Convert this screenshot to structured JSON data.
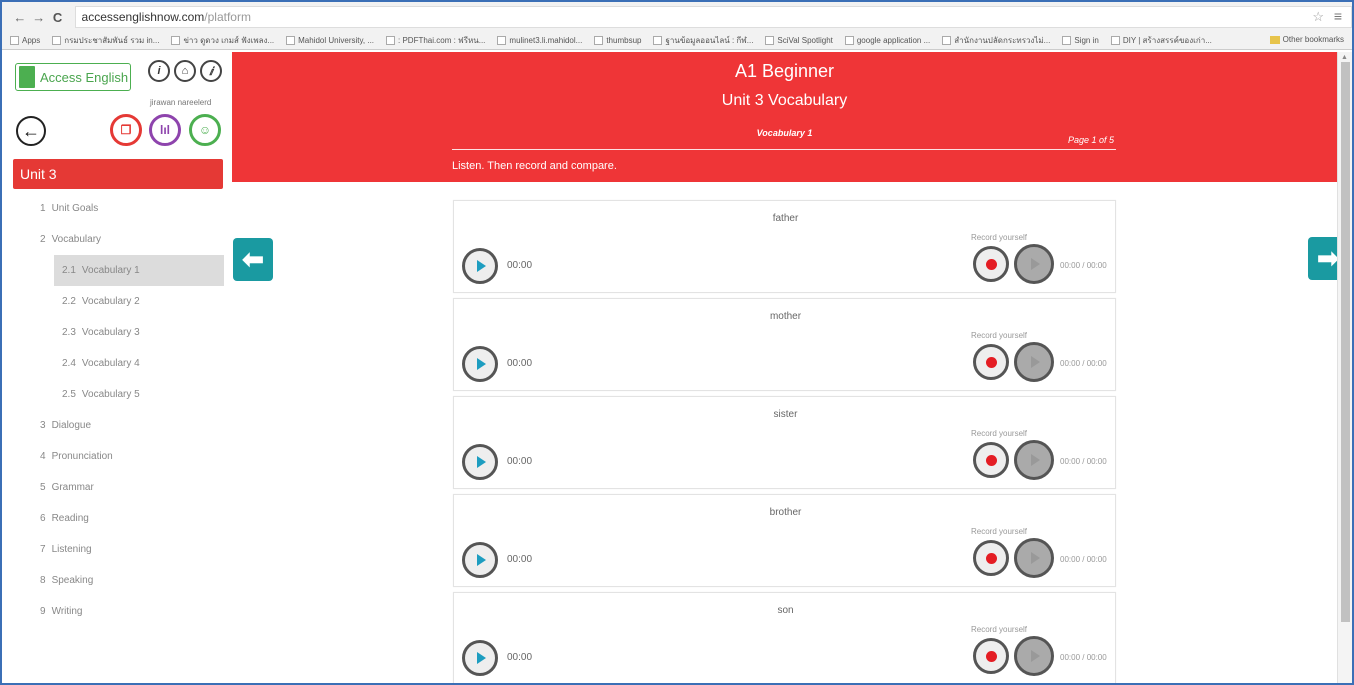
{
  "browser": {
    "url_host": "accessenglishnow.com",
    "url_path": "/platform",
    "bookmarks": [
      "Apps",
      "กรมประชาสัมพันธ์ รวม in...",
      "ข่าว ดูดวง เกมส์ ฟังเพลง...",
      "Mahidol University, ...",
      ": PDFThai.com : ฟรีหน...",
      "mulinet3.li.mahidol...",
      "thumbsup",
      "ฐานข้อมูลออนไลน์ : กีฬ...",
      "SciVal Spotlight",
      "google application ...",
      "สำนักงานปลัดกระทรวงไม่...",
      "Sign in",
      "DIY | สร้างสรรค์ของเก่า..."
    ],
    "other_bookmarks": "Other bookmarks"
  },
  "sidebar": {
    "logo_text": "Access English",
    "username": "jirawan nareelerd",
    "unit_title": "Unit 3",
    "menu": [
      {
        "num": "1",
        "label": "Unit Goals",
        "level": "top"
      },
      {
        "num": "2",
        "label": "Vocabulary",
        "level": "top"
      },
      {
        "num": "2.1",
        "label": "Vocabulary 1",
        "level": "sub",
        "active": true
      },
      {
        "num": "2.2",
        "label": "Vocabulary 2",
        "level": "sub"
      },
      {
        "num": "2.3",
        "label": "Vocabulary 3",
        "level": "sub"
      },
      {
        "num": "2.4",
        "label": "Vocabulary 4",
        "level": "sub"
      },
      {
        "num": "2.5",
        "label": "Vocabulary 5",
        "level": "sub"
      },
      {
        "num": "3",
        "label": "Dialogue",
        "level": "top"
      },
      {
        "num": "4",
        "label": "Pronunciation",
        "level": "top"
      },
      {
        "num": "5",
        "label": "Grammar",
        "level": "top"
      },
      {
        "num": "6",
        "label": "Reading",
        "level": "top"
      },
      {
        "num": "7",
        "label": "Listening",
        "level": "top"
      },
      {
        "num": "8",
        "label": "Speaking",
        "level": "top"
      },
      {
        "num": "9",
        "label": "Writing",
        "level": "top"
      }
    ]
  },
  "header": {
    "level": "A1 Beginner",
    "unit": "Unit 3 Vocabulary",
    "subtitle": "Vocabulary 1",
    "page": "Page 1 of 5",
    "instruction": "Listen. Then record and compare."
  },
  "cards": [
    {
      "word": "father",
      "play_time": "00:00",
      "record_label": "Record yourself",
      "record_time": "00:00 / 00:00"
    },
    {
      "word": "mother",
      "play_time": "00:00",
      "record_label": "Record yourself",
      "record_time": "00:00 / 00:00"
    },
    {
      "word": "sister",
      "play_time": "00:00",
      "record_label": "Record yourself",
      "record_time": "00:00 / 00:00"
    },
    {
      "word": "brother",
      "play_time": "00:00",
      "record_label": "Record yourself",
      "record_time": "00:00 / 00:00"
    },
    {
      "word": "son",
      "play_time": "00:00",
      "record_label": "Record yourself",
      "record_time": "00:00 / 00:00"
    }
  ],
  "colors": {
    "header_red": "#ef3537",
    "teal": "#1a9aa1",
    "green": "#4caf50",
    "purple": "#8e44ad"
  }
}
